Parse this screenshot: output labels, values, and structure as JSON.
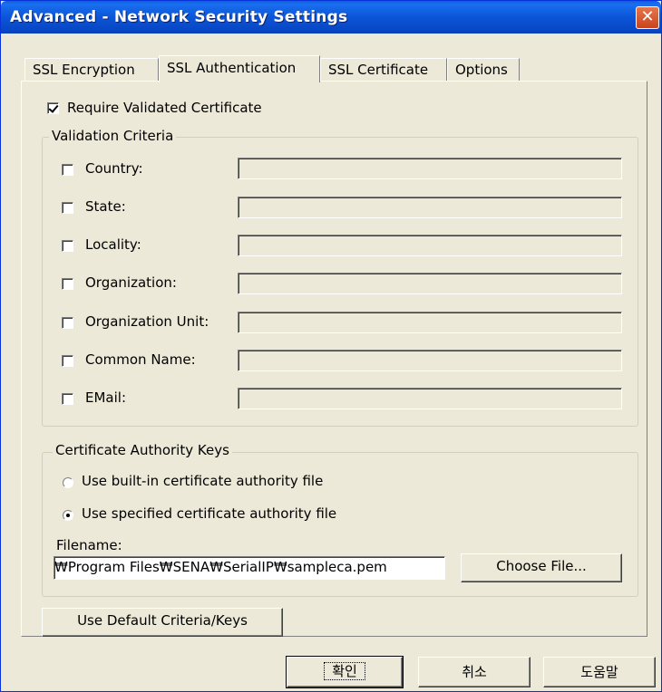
{
  "window": {
    "title": "Advanced - Network Security Settings",
    "close_label": "✕"
  },
  "tabs": [
    "SSL Encryption",
    "SSL Authentication",
    "SSL Certificate",
    "Options"
  ],
  "active_tab": "SSL Authentication",
  "require_validated": {
    "label": "Require Validated Certificate",
    "checked": true
  },
  "validation": {
    "title": "Validation Criteria",
    "fields": [
      {
        "label": "Country:",
        "checked": false,
        "value": ""
      },
      {
        "label": "State:",
        "checked": false,
        "value": ""
      },
      {
        "label": "Locality:",
        "checked": false,
        "value": ""
      },
      {
        "label": "Organization:",
        "checked": false,
        "value": ""
      },
      {
        "label": "Organization Unit:",
        "checked": false,
        "value": ""
      },
      {
        "label": "Common Name:",
        "checked": false,
        "value": ""
      },
      {
        "label": "EMail:",
        "checked": false,
        "value": ""
      }
    ]
  },
  "ca_keys": {
    "title": "Certificate Authority Keys",
    "option_builtin": "Use built-in certificate authority file",
    "option_specified": "Use specified certificate authority file",
    "selected": "specified",
    "filename_label": "Filename:",
    "filename_value": "₩Program Files₩SENA₩SerialIP₩sampleca.pem",
    "choose_label": "Choose File..."
  },
  "default_button": "Use Default Criteria/Keys",
  "footer": {
    "ok": "확인",
    "cancel": "취소",
    "help": "도움말"
  }
}
